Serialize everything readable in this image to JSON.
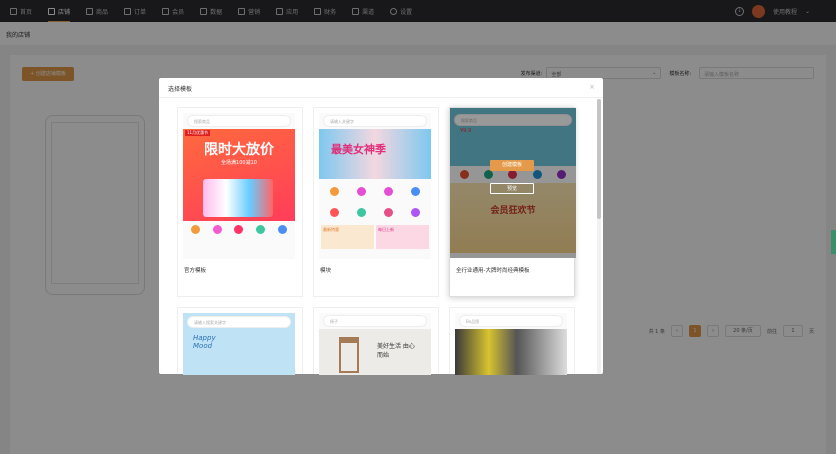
{
  "nav": {
    "items": [
      {
        "label": "首页",
        "icon": "home-icon"
      },
      {
        "label": "店铺",
        "icon": "shop-icon",
        "active": true
      },
      {
        "label": "商品",
        "icon": "goods-icon"
      },
      {
        "label": "订单",
        "icon": "order-icon"
      },
      {
        "label": "会员",
        "icon": "member-icon"
      },
      {
        "label": "数据",
        "icon": "data-icon"
      },
      {
        "label": "营销",
        "icon": "tag-icon"
      },
      {
        "label": "应用",
        "icon": "app-icon"
      },
      {
        "label": "财务",
        "icon": "finance-icon"
      },
      {
        "label": "渠道",
        "icon": "channel-icon"
      },
      {
        "label": "设置",
        "icon": "settings-icon"
      }
    ],
    "user": "使用教程"
  },
  "breadcrumb": "我的店铺",
  "toolbar": {
    "create_label": "+ 创建店铺模板",
    "channel_label": "发布渠道:",
    "channel_value": "全部",
    "name_label": "模板名称:",
    "name_placeholder": "请输入模板名称"
  },
  "pager": {
    "total": "共 1 条",
    "page": "1",
    "size": "20 条/页",
    "goto": "前往",
    "goto_value": "1",
    "page_unit": "页"
  },
  "modal": {
    "title": "选择模板",
    "close": "×",
    "cards": [
      {
        "label": "官方模板",
        "search": "搜索商品",
        "banner": "限时大放价",
        "sub": "全场满100减10",
        "tag": "11月优惠节"
      },
      {
        "label": "模块",
        "search": "请输入关键字",
        "banner": "最美女神季",
        "sub1": "最新特惠",
        "sub2": "每日上新"
      },
      {
        "label": "全行业通用-大牌时尚经典模板",
        "search": "搜索商品",
        "banner": "会员狂欢节",
        "price": "¥9.9",
        "create": "创建模板",
        "preview": "预览"
      },
      {
        "label": "",
        "search": "请输入搜索关键字",
        "banner": "Happy Mood"
      },
      {
        "label": "",
        "search": "椅子",
        "banner": "美好生活 由心而始"
      },
      {
        "label": "",
        "search": "Bo品图"
      }
    ]
  }
}
